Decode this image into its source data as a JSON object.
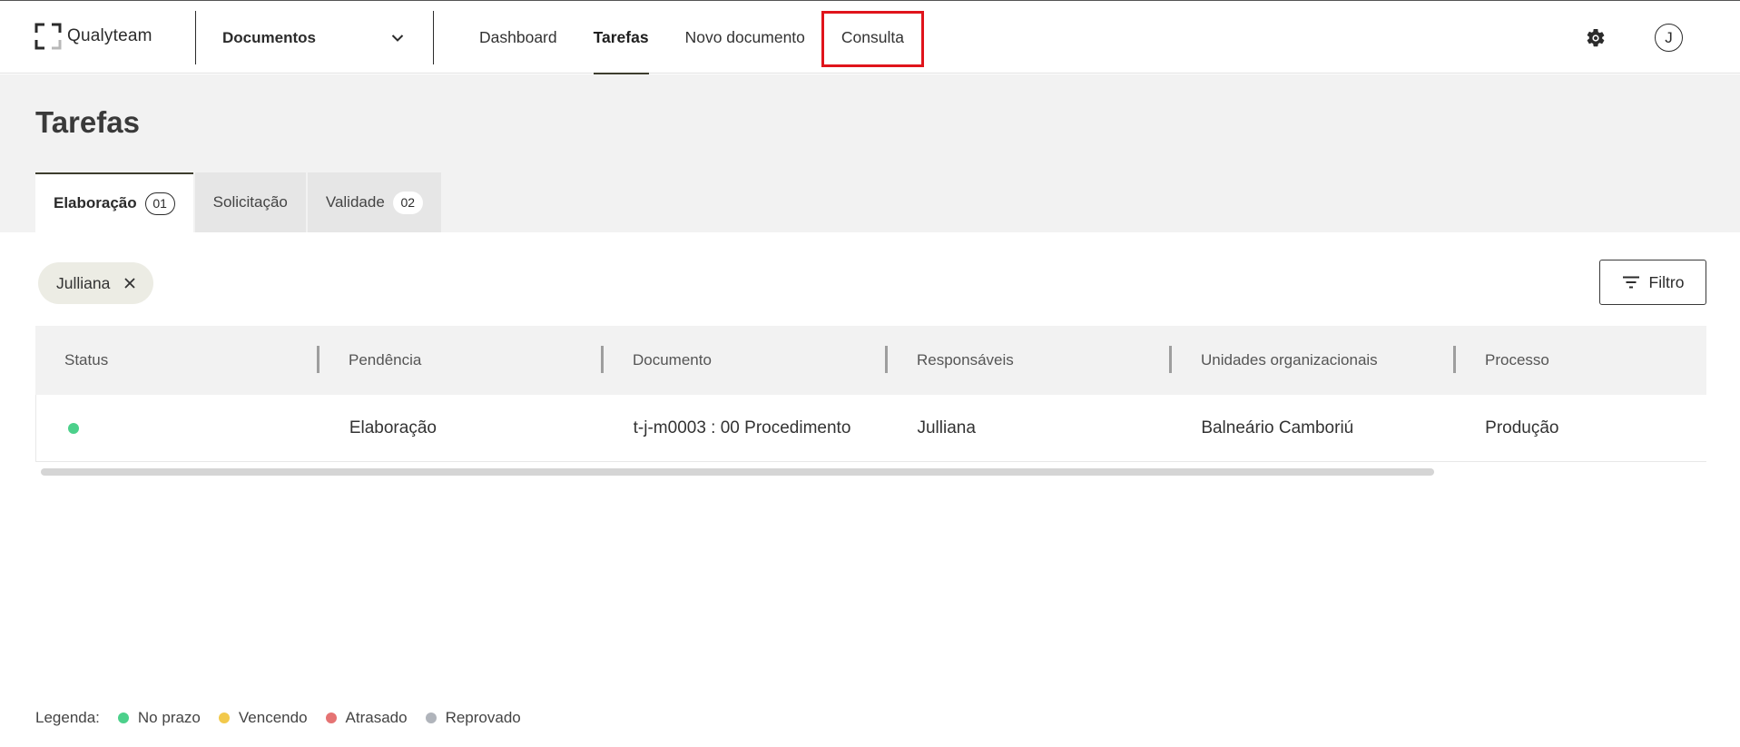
{
  "header": {
    "brand": "Qualyteam",
    "module": "Documentos",
    "nav": [
      {
        "label": "Dashboard",
        "active": false
      },
      {
        "label": "Tarefas",
        "active": true
      },
      {
        "label": "Novo documento",
        "active": false
      },
      {
        "label": "Consulta",
        "active": false
      }
    ],
    "avatar_initial": "J",
    "highlight_color": "#e0141b"
  },
  "page": {
    "title": "Tarefas",
    "tabs": [
      {
        "label": "Elaboração",
        "count": "01",
        "active": true
      },
      {
        "label": "Solicitação",
        "count": "",
        "active": false
      },
      {
        "label": "Validade",
        "count": "02",
        "active": false
      }
    ]
  },
  "filters": {
    "chip_label": "Julliana",
    "button_label": "Filtro"
  },
  "table": {
    "columns": [
      "Status",
      "Pendência",
      "Documento",
      "Responsáveis",
      "Unidades organizacionais",
      "Processo"
    ],
    "rows": [
      {
        "status_color": "#4cd08b",
        "pendencia": "Elaboração",
        "documento": "t-j-m0003 : 00 Procedimento",
        "responsaveis": "Julliana",
        "unidades": "Balneário Camboriú",
        "processo": "Produção"
      }
    ]
  },
  "legend": {
    "title": "Legenda:",
    "items": [
      {
        "label": "No prazo",
        "color": "#4cd08b"
      },
      {
        "label": "Vencendo",
        "color": "#f2c94c"
      },
      {
        "label": "Atrasado",
        "color": "#e57373"
      },
      {
        "label": "Reprovado",
        "color": "#b0b4bb"
      }
    ]
  }
}
